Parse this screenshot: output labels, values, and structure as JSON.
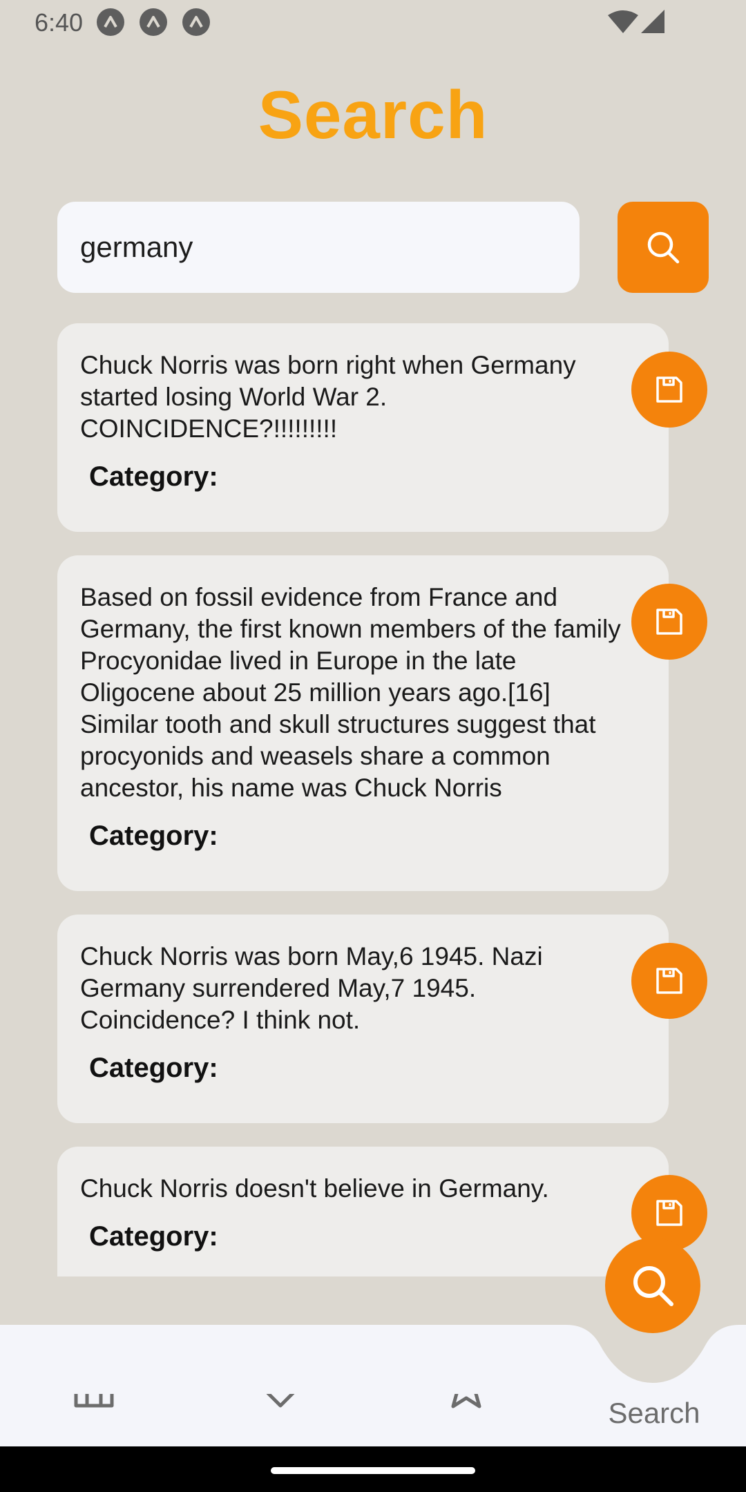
{
  "status_bar": {
    "time": "6:40",
    "notification_icons": [
      "app-notification-icon",
      "app-notification-icon",
      "app-notification-icon"
    ],
    "system_icons": [
      "wifi-icon",
      "cellular-signal-icon"
    ]
  },
  "header": {
    "title": "Search"
  },
  "search": {
    "value": "germany",
    "button_icon": "search-icon"
  },
  "results": [
    {
      "text": "Chuck Norris was born right when Germany started losing World War 2. COINCIDENCE?!!!!!!!!!",
      "category_label": "Category:",
      "category_value": "",
      "save_icon": "save-icon"
    },
    {
      "text": "Based on fossil evidence from France and Germany, the first known members of the family Procyonidae lived in Europe in the late Oligocene about 25 million years ago.[16] Similar tooth and skull structures suggest that procyonids and weasels share a common ancestor, his name was Chuck Norris",
      "category_label": "Category:",
      "category_value": "",
      "save_icon": "save-icon"
    },
    {
      "text": "Chuck Norris was born May,6 1945. Nazi Germany surrendered May,7 1945. Coincidence? I think not.",
      "category_label": "Category:",
      "category_value": "",
      "save_icon": "save-icon"
    },
    {
      "text": "Chuck Norris doesn't believe in Germany.",
      "category_label": "Category:",
      "category_value": "",
      "save_icon": "save-icon"
    }
  ],
  "fab": {
    "icon": "search-icon"
  },
  "bottom_nav": {
    "items": [
      {
        "icon": "home-icon",
        "label": ""
      },
      {
        "icon": "tag-icon",
        "label": ""
      },
      {
        "icon": "star-icon",
        "label": ""
      },
      {
        "icon": "search-icon",
        "label": "Search",
        "active": true
      }
    ]
  },
  "colors": {
    "accent": "#f4830c",
    "title": "#f8a313",
    "background": "#dcd8d0",
    "card": "#eeedeb",
    "nav_background": "#f4f5fa"
  }
}
